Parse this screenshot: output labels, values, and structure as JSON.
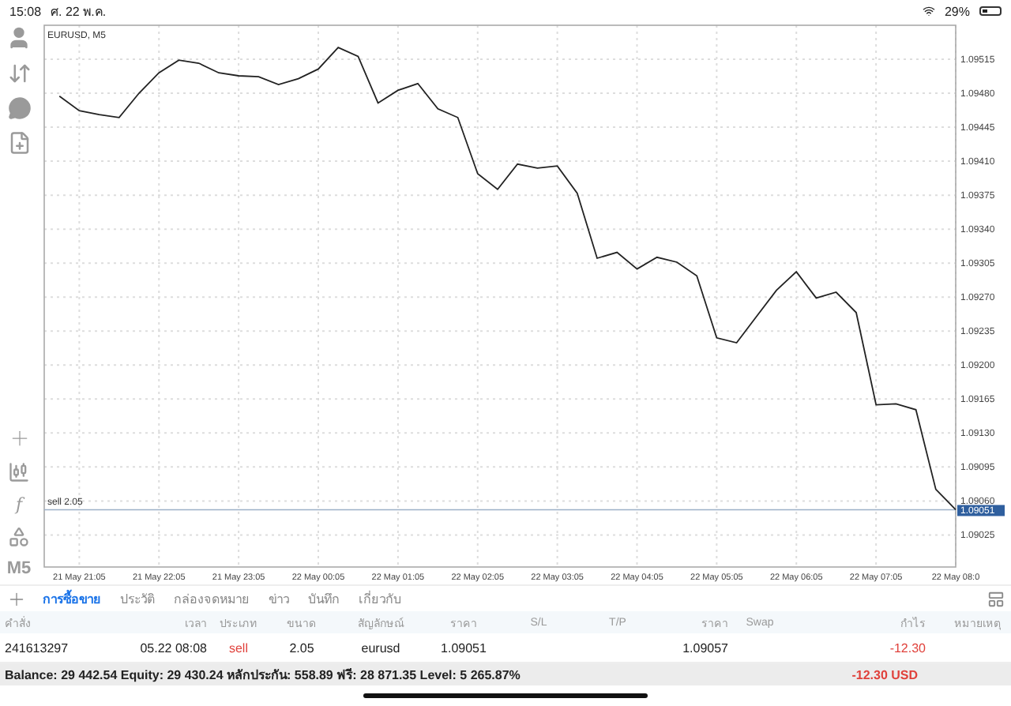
{
  "status_bar": {
    "time": "15:08",
    "date": "ศ. 22 พ.ค.",
    "battery": "29%"
  },
  "toolbar": {
    "function_glyph": "f",
    "timeframe": "M5"
  },
  "chart": {
    "title": "EURUSD, M5",
    "current_price": "1.09051",
    "chart_data": {
      "type": "line",
      "ylim": [
        1.08992,
        1.0955
      ],
      "categories": [
        null,
        "21 May 21:05",
        null,
        null,
        null,
        "21 May 22:05",
        null,
        null,
        null,
        "21 May 23:05",
        null,
        null,
        null,
        "22 May 00:05",
        null,
        null,
        null,
        "22 May 01:05",
        null,
        null,
        null,
        "22 May 02:05",
        null,
        null,
        null,
        "22 May 03:05",
        null,
        null,
        null,
        "22 May 04:05",
        null,
        null,
        null,
        "22 May 05:05",
        null,
        null,
        null,
        "22 May 06:05",
        null,
        null,
        null,
        "22 May 07:05",
        null,
        null,
        null,
        "22 May 08:0"
      ],
      "series": [
        {
          "color": "#222222",
          "values": [
            1.09477,
            1.09462,
            1.09458,
            1.09455,
            1.0948,
            1.09501,
            1.09514,
            1.09511,
            1.09501,
            1.09498,
            1.09497,
            1.09489,
            1.09495,
            1.09505,
            1.09527,
            1.09518,
            1.0947,
            1.09483,
            1.0949,
            1.09464,
            1.09455,
            1.09397,
            1.09381,
            1.09407,
            1.09403,
            1.09405,
            1.09377,
            1.0931,
            1.09316,
            1.09299,
            1.09311,
            1.09306,
            1.09292,
            1.09228,
            1.09223,
            1.0925,
            1.09277,
            1.09296,
            1.09269,
            1.09275,
            1.09254,
            1.09159,
            1.0916,
            1.09154,
            1.09072,
            1.09051
          ]
        }
      ],
      "yticks": [
        {
          "value": 1.09025,
          "label": "1.09025"
        },
        {
          "value": 1.0906,
          "label": "1.09060"
        },
        {
          "value": 1.09095,
          "label": "1.09095"
        },
        {
          "value": 1.0913,
          "label": "1.09130"
        },
        {
          "value": 1.09165,
          "label": "1.09165"
        },
        {
          "value": 1.092,
          "label": "1.09200"
        },
        {
          "value": 1.09235,
          "label": "1.09235"
        },
        {
          "value": 1.0927,
          "label": "1.09270"
        },
        {
          "value": 1.09305,
          "label": "1.09305"
        },
        {
          "value": 1.0934,
          "label": "1.09340"
        },
        {
          "value": 1.09375,
          "label": "1.09375"
        },
        {
          "value": 1.0941,
          "label": "1.09410"
        },
        {
          "value": 1.09445,
          "label": "1.09445"
        },
        {
          "value": 1.0948,
          "label": "1.09480"
        },
        {
          "value": 1.09515,
          "label": "1.09515"
        }
      ],
      "grid": true,
      "ref_lines": [
        {
          "axis": "y",
          "value": 1.09051,
          "label": "sell 2.05",
          "color": "#9bb0c8"
        }
      ]
    }
  },
  "tabs": [
    {
      "label": "การซื้อขาย",
      "selected": true
    },
    {
      "label": "ประวัติ",
      "selected": false
    },
    {
      "label": "กล่องจดหมาย",
      "selected": false
    },
    {
      "label": "ข่าว",
      "selected": false
    },
    {
      "label": "บันทึก",
      "selected": false
    },
    {
      "label": "เกี่ยวกับ",
      "selected": false
    }
  ],
  "trade_table": {
    "columns": [
      "คำสั่ง",
      "เวลา",
      "ประเภท",
      "ขนาด",
      "สัญลักษณ์",
      "ราคา",
      "S/L",
      "T/P",
      "ราคา",
      "Swap",
      "กำไร",
      "หมายเหตุ"
    ],
    "rows": [
      {
        "cells": [
          {
            "text": "241613297"
          },
          {
            "text": "05.22 08:08"
          },
          {
            "text": "sell",
            "color": "#e0413b"
          },
          {
            "text": "2.05"
          },
          {
            "text": "eurusd"
          },
          {
            "text": "1.09051"
          },
          {
            "text": ""
          },
          {
            "text": ""
          },
          {
            "text": "1.09057"
          },
          {
            "text": ""
          },
          {
            "text": "-12.30",
            "color": "#e0413b"
          },
          {
            "text": ""
          }
        ]
      }
    ]
  },
  "summary": {
    "text": "Balance: 29 442.54 Equity: 29 430.24 หลักประกัน: 558.89 ฟรี: 28 871.35 Level: 5 265.87%",
    "profit": "-12.30  USD"
  }
}
